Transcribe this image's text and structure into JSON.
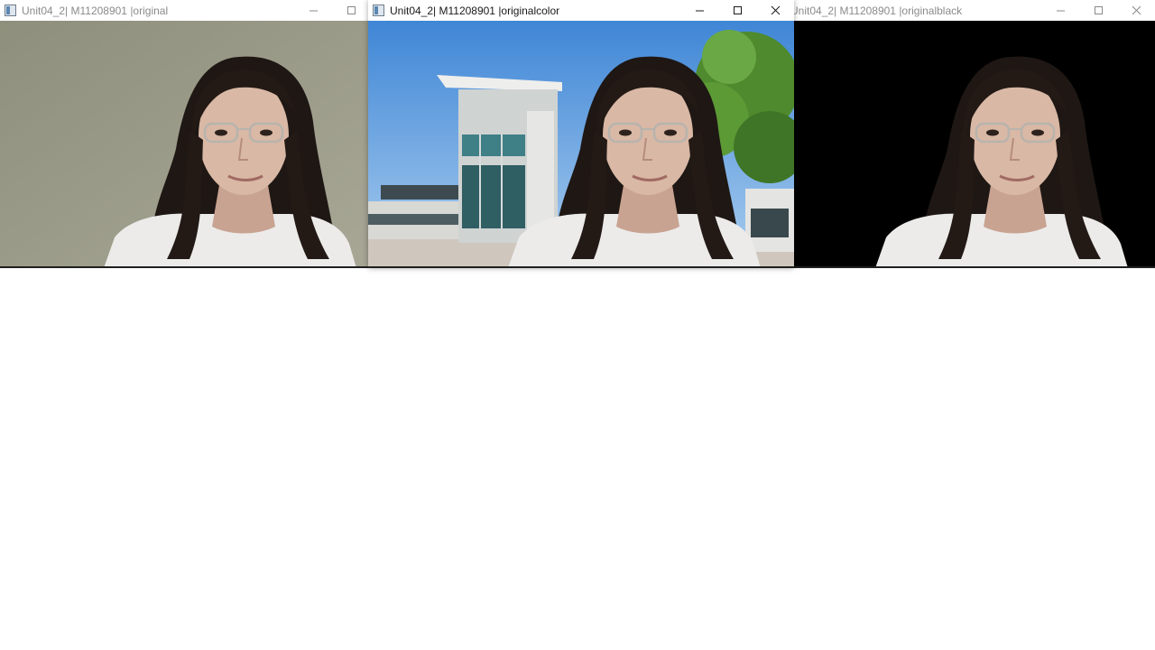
{
  "windows": {
    "left": {
      "title": "Unit04_2| M11208901 |original",
      "state": "inactive",
      "content": "webcam-original-frame"
    },
    "center": {
      "title": "Unit04_2| M11208901 |originalcolor",
      "state": "active",
      "content": "webcam-frame-with-building-background"
    },
    "right": {
      "title": "Unit04_2| M11208901 |originalblack",
      "state": "inactive",
      "content": "webcam-frame-with-black-background"
    }
  },
  "icons": {
    "app": "window-app-icon",
    "minimize": "minimize-icon",
    "maximize": "maximize-icon",
    "close": "close-icon"
  },
  "colors": {
    "titlebar_bg": "#ffffff",
    "active_title_text": "#1a1a1a",
    "inactive_title_text": "#8a8a8a",
    "wall_bg": "#9a9a86",
    "sky": "#4f93d8",
    "black_bg": "#000000",
    "hair": "#1e1714",
    "skin": "#d9b8a5",
    "shirt": "#eceaea"
  }
}
